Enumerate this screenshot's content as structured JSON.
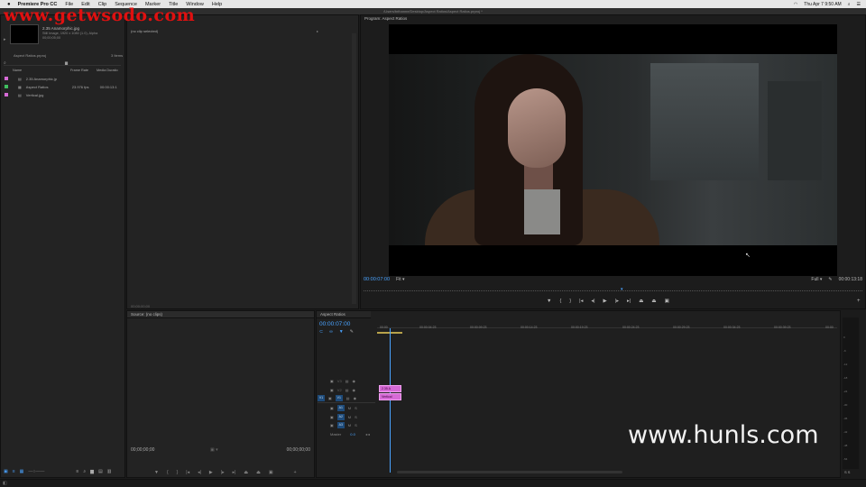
{
  "menubar": {
    "apple": "",
    "app_name": "Premiere Pro CC",
    "items": [
      "File",
      "Edit",
      "Clip",
      "Sequence",
      "Marker",
      "Title",
      "Window",
      "Help"
    ],
    "clock": "Thu Apr 7  9:50 AM"
  },
  "window_title": "/Users/brihanne/Desktop/Aspect Ratios/Aspect Ratios.prproj *",
  "watermarks": {
    "top": "www.getwsodo.com",
    "bottom": "www.hunls.com"
  },
  "project_panel": {
    "clip_name": "2.35 Anamorphic.jpg",
    "clip_info": "Still Image, 1920 x 1080 (1.0), Alpha",
    "clip_duration": "00;00;05;00",
    "project_file": "Aspect Ratios.prproj",
    "item_count": "3 Items",
    "columns": [
      "Name",
      "Frame Rate",
      "Media Duratio"
    ],
    "rows": [
      {
        "name": "2.35 Anamorphic.jp",
        "rate": "",
        "duration": "",
        "color": "#d66ad6"
      },
      {
        "name": "Aspect Ratios",
        "rate": "23.976 fps",
        "duration": "00:00:13:1",
        "color": "#3fbf5f"
      },
      {
        "name": "Vertical.jpg",
        "rate": "",
        "duration": "",
        "color": "#d66ad6"
      }
    ]
  },
  "effect_controls": {
    "status": "(no clip selected)",
    "timecode": "00;00;00;00"
  },
  "program_monitor": {
    "title": "Program: Aspect Ratios",
    "timecode": "00:00:07:00",
    "fit": "Fit",
    "quality": "Full",
    "duration": "00:00:13:18"
  },
  "source_monitor": {
    "title": "Source: (no clips)",
    "tc_left": "00;00;00;00",
    "tc_right": "00;00;00;00"
  },
  "timeline": {
    "tab": "Aspect Ratios",
    "timecode": "00:00:07:00",
    "ruler": [
      "00:00",
      "00:00:04:23",
      "00:00:09:23",
      "00:00:14:23",
      "00:00:19:23",
      "00:00:24:23",
      "00:00:29:23",
      "00:00:34:23",
      "00:00:39:23",
      "00:00"
    ],
    "tracks": [
      "V3",
      "V2",
      "V1",
      "A1",
      "A2",
      "A3"
    ],
    "master_label": "Master",
    "master_value": "0.0",
    "clips": [
      {
        "label": "2.35 A",
        "track": "V2"
      },
      {
        "label": "Vertical",
        "track": "V1"
      }
    ]
  },
  "meter_scale": [
    "0",
    "-6",
    "-12",
    "-18",
    "-24",
    "-30",
    "-36",
    "-42",
    "-48",
    "-54"
  ],
  "colors": {
    "accent": "#4aa3ff",
    "clip": "#d66ad6",
    "watermark_red": "#e01010"
  }
}
